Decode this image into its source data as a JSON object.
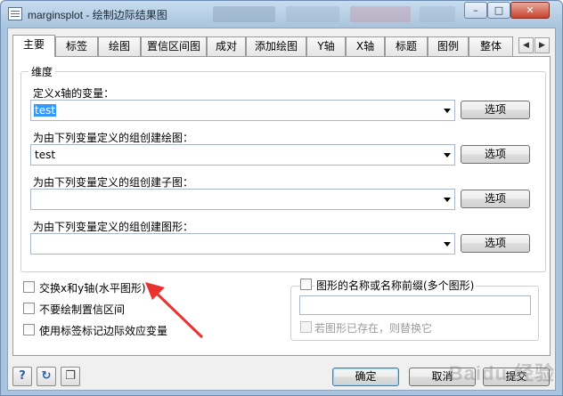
{
  "window": {
    "title": "marginsplot - 绘制边际结果图"
  },
  "tabs": [
    {
      "label": "主要"
    },
    {
      "label": "标签"
    },
    {
      "label": "绘图"
    },
    {
      "label": "置信区间图"
    },
    {
      "label": "成对"
    },
    {
      "label": "添加绘图"
    },
    {
      "label": "Y轴"
    },
    {
      "label": "X轴"
    },
    {
      "label": "标题"
    },
    {
      "label": "图例"
    },
    {
      "label": "整体"
    }
  ],
  "dimensions": {
    "group_title": "维度",
    "fields": [
      {
        "label": "定义x轴的变量：",
        "value": "test",
        "selected": true,
        "button": "选项"
      },
      {
        "label": "为由下列变量定义的组创建绘图：",
        "value": "test",
        "selected": false,
        "button": "选项"
      },
      {
        "label": "为由下列变量定义的组创建子图：",
        "value": "",
        "selected": false,
        "button": "选项"
      },
      {
        "label": "为由下列变量定义的组创建图形：",
        "value": "",
        "selected": false,
        "button": "选项"
      }
    ]
  },
  "options": {
    "swap_xy": "交换x和y轴(水平图形)",
    "no_ci": "不要绘制置信区间",
    "use_labels": "使用标签标记边际效应变量"
  },
  "graph_name": {
    "checkbox_label": "图形的名称或名称前缀(多个图形)",
    "value": "",
    "replace_label": "若图形已存在，则替换它"
  },
  "footer": {
    "ok": "确定",
    "cancel": "取消",
    "submit": "提交"
  },
  "watermark": "Baidu 经验",
  "colors": {
    "annotation_arrow": "#e8332f",
    "selection": "#3399ff"
  }
}
